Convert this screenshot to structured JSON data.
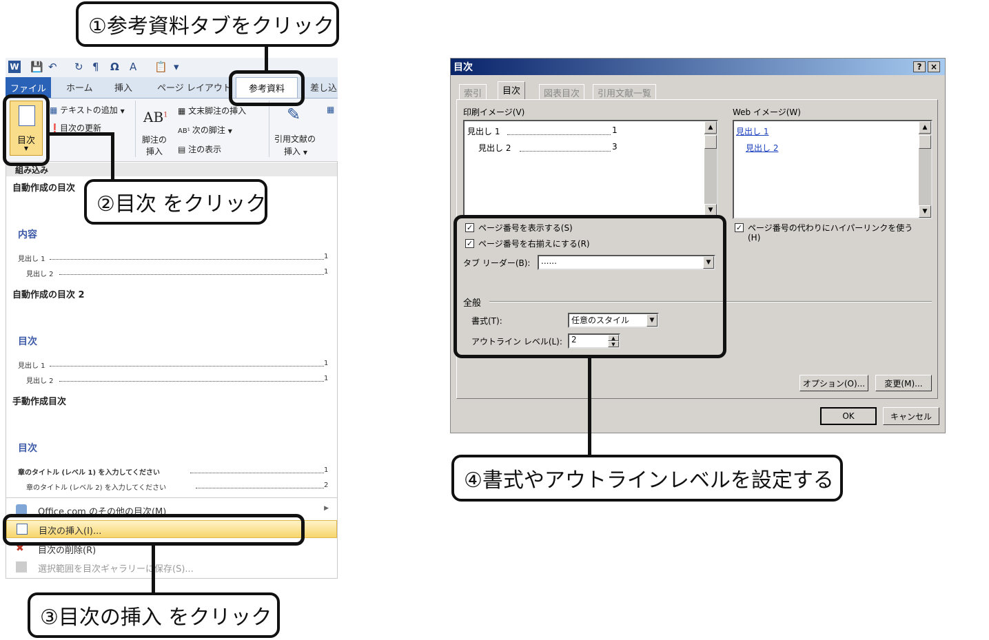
{
  "callouts": {
    "step1": "①参考資料タブをクリック",
    "step2": "②目次 をクリック",
    "step3": "③目次の挿入 をクリック",
    "step4": "④書式やアウトラインレベルを設定する"
  },
  "ribbon": {
    "tabs": {
      "file": "ファイル",
      "home": "ホーム",
      "insert": "挿入",
      "page_layout": "ページ レイアウト",
      "references": "参考資料",
      "mailings": "差し込"
    },
    "toc_group": {
      "add_text": "テキストの追加",
      "update_toc": "目次の更新",
      "toc_button": "目次"
    },
    "footnotes_group": {
      "ab_label": "AB",
      "insert_footnote_line1": "脚注の",
      "insert_footnote_line2": "挿入",
      "insert_endnote": "文末脚注の挿入",
      "next_footnote": "次の脚注",
      "show_notes": "注の表示"
    },
    "citations_group": {
      "insert_citation_line1": "引用文献の",
      "insert_citation_line2": "挿入"
    }
  },
  "gallery": {
    "builtin_header": "組み込み",
    "auto1": {
      "title": "自動作成の目次",
      "heading": "内容",
      "lines": [
        {
          "text": "見出し 1",
          "page": "1"
        },
        {
          "text": "見出し 2",
          "page": "1"
        }
      ]
    },
    "auto2": {
      "title": "自動作成の目次 2",
      "heading": "目次",
      "lines": [
        {
          "text": "見出し 1",
          "page": "1"
        },
        {
          "text": "見出し 2",
          "page": "1"
        }
      ]
    },
    "manual": {
      "title": "手動作成目次",
      "heading": "目次",
      "lines": [
        {
          "text": "章のタイトル (レベル 1) を入力してください",
          "page": "1"
        },
        {
          "text": "章のタイトル (レベル 2) を入力してください",
          "page": "2"
        }
      ]
    },
    "menu": {
      "more_office": "Office.com のその他の目次(M)",
      "insert_toc": "目次の挿入(I)...",
      "remove_toc": "目次の削除(R)",
      "save_selection": "選択範囲を目次ギャラリーに保存(S)..."
    }
  },
  "dialog": {
    "title": "目次",
    "help_btn": "?",
    "close_btn": "×",
    "tabs": [
      "索引",
      "目次",
      "図表目次",
      "引用文献一覧"
    ],
    "print_preview_label": "印刷イメージ(V)",
    "print_preview": [
      {
        "text": "見出し 1",
        "page": "1"
      },
      {
        "text": "見出し 2",
        "page": "3"
      }
    ],
    "web_preview_label": "Web イメージ(W)",
    "web_preview": [
      "見出し 1",
      "見出し 2"
    ],
    "show_page_numbers": "ページ番号を表示する(S)",
    "right_align": "ページ番号を右揃えにする(R)",
    "hyperlinks_line1": "ページ番号の代わりにハイパーリンクを使う",
    "hyperlinks_line2": "(H)",
    "tab_leader_label": "タブ リーダー(B):",
    "tab_leader_value": "......",
    "general_label": "全般",
    "format_label": "書式(T):",
    "format_value": "任意のスタイル",
    "outline_label": "アウトライン レベル(L):",
    "outline_value": "2",
    "options_btn": "オプション(O)...",
    "modify_btn": "変更(M)...",
    "ok_btn": "OK",
    "cancel_btn": "キャンセル"
  }
}
